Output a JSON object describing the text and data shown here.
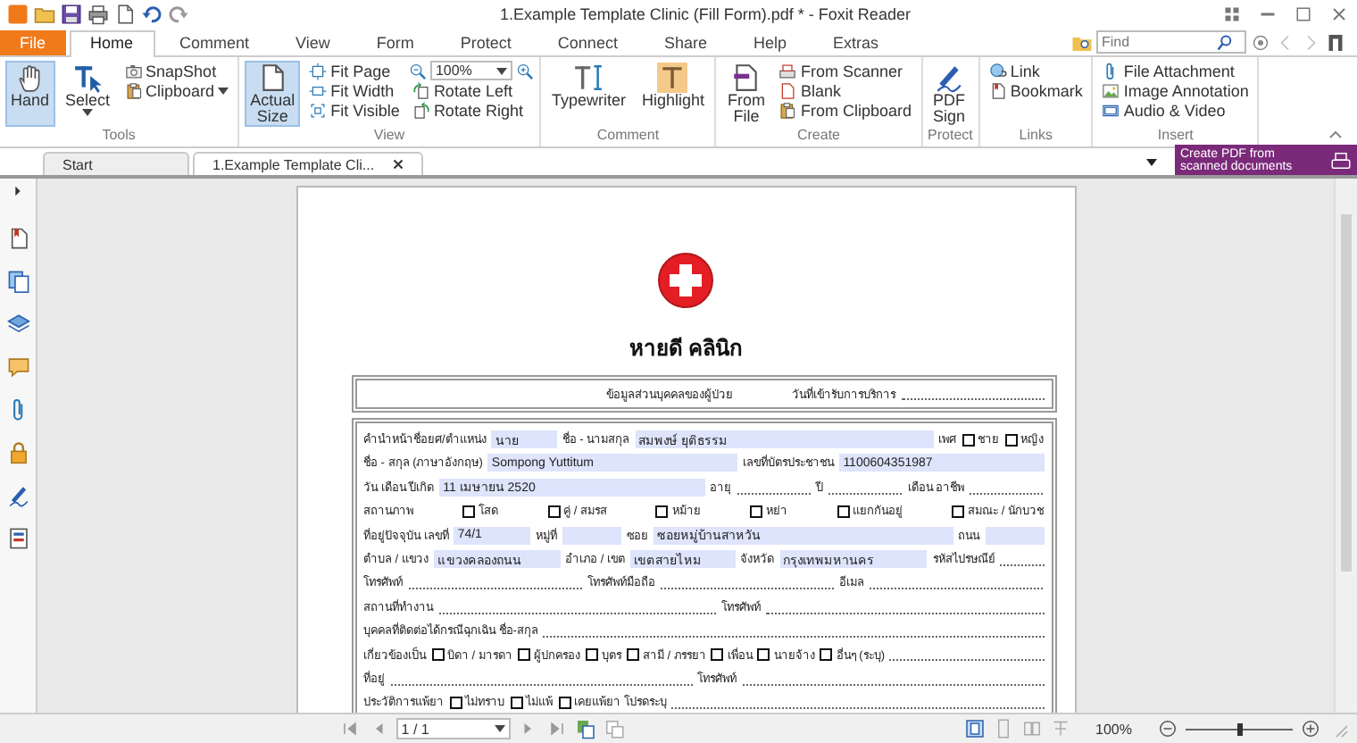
{
  "window": {
    "title": "1.Example Template Clinic (Fill Form).pdf * - Foxit Reader"
  },
  "menu_tabs": [
    {
      "label": "File",
      "kind": "file",
      "selected": false
    },
    {
      "label": "Home",
      "kind": "tab",
      "selected": true
    },
    {
      "label": "Comment",
      "kind": "tab",
      "selected": false
    },
    {
      "label": "View",
      "kind": "tab",
      "selected": false
    },
    {
      "label": "Form",
      "kind": "tab",
      "selected": false
    },
    {
      "label": "Protect",
      "kind": "tab",
      "selected": false
    },
    {
      "label": "Connect",
      "kind": "tab",
      "selected": false
    },
    {
      "label": "Share",
      "kind": "tab",
      "selected": false
    },
    {
      "label": "Help",
      "kind": "tab",
      "selected": false
    },
    {
      "label": "Extras",
      "kind": "tab",
      "selected": false
    }
  ],
  "find": {
    "placeholder": "Find"
  },
  "ribbon": [
    {
      "label": "Tools",
      "items": [
        {
          "label": "Hand",
          "kind": "large",
          "selected": true
        },
        {
          "label": "Select",
          "kind": "large",
          "selected": false,
          "dropdown": true
        },
        {
          "label": "SnapShot",
          "kind": "small",
          "selected": false
        },
        {
          "label": "Clipboard",
          "kind": "small",
          "selected": false,
          "dropdown": true
        }
      ]
    },
    {
      "label": "View",
      "items": [
        {
          "label": "Actual Size",
          "kind": "large",
          "selected": true
        },
        {
          "label": "Fit Page",
          "kind": "small",
          "selected": false
        },
        {
          "label": "Fit Width",
          "kind": "small",
          "selected": false
        },
        {
          "label": "Fit Visible",
          "kind": "small",
          "selected": false
        },
        {
          "kind": "zoom",
          "value": "100%"
        },
        {
          "label": "Rotate Left",
          "kind": "small",
          "selected": false
        },
        {
          "label": "Rotate Right",
          "kind": "small",
          "selected": false
        }
      ]
    },
    {
      "label": "Comment",
      "items": [
        {
          "label": "Typewriter",
          "kind": "large",
          "selected": false
        },
        {
          "label": "Highlight",
          "kind": "large",
          "selected": false
        }
      ]
    },
    {
      "label": "Create",
      "items": [
        {
          "label": "From File",
          "kind": "large",
          "selected": false
        },
        {
          "label": "From Scanner",
          "kind": "small",
          "selected": false
        },
        {
          "label": "Blank",
          "kind": "small",
          "selected": false
        },
        {
          "label": "From Clipboard",
          "kind": "small",
          "selected": false
        }
      ]
    },
    {
      "label": "Protect",
      "items": [
        {
          "label": "PDF Sign",
          "kind": "large",
          "selected": false
        }
      ]
    },
    {
      "label": "Links",
      "items": [
        {
          "label": "Link",
          "kind": "small",
          "selected": false
        },
        {
          "label": "Bookmark",
          "kind": "small",
          "selected": false
        }
      ]
    },
    {
      "label": "Insert",
      "items": [
        {
          "label": "File Attachment",
          "kind": "small",
          "selected": false
        },
        {
          "label": "Image Annotation",
          "kind": "small",
          "selected": false
        },
        {
          "label": "Audio & Video",
          "kind": "small",
          "selected": false
        }
      ]
    }
  ],
  "doc_tabs": [
    {
      "label": "Start",
      "selected": false
    },
    {
      "label": "1.Example Template Cli...",
      "selected": true,
      "closable": true
    }
  ],
  "promo": {
    "text": "Create PDF from scanned documents"
  },
  "document": {
    "title": "หายดี คลินิก",
    "header": [
      {
        "kind": "text",
        "text": "ข้อมูลส่วนบุคคลของผู้ป่วย"
      },
      {
        "kind": "text",
        "text": "วันที่เข้ารับการบริการ",
        "leader": true
      }
    ],
    "rows": [
      {
        "items": [
          {
            "kind": "text",
            "text": "คำนำหน้าชื่อยศ/ตำแหน่ง"
          },
          {
            "kind": "field",
            "value": "นาย"
          },
          {
            "kind": "text",
            "text": "ชื่อ - นามสกุล"
          },
          {
            "kind": "field",
            "value": "สมพงษ์ ยุติธรรม"
          },
          {
            "kind": "text",
            "text": "เพศ"
          },
          {
            "kind": "check",
            "text": "ชาย",
            "checked": false
          },
          {
            "kind": "check",
            "text": "หญิง",
            "checked": false
          }
        ]
      },
      {
        "items": [
          {
            "kind": "text",
            "text": "ชื่อ - สกุล (ภาษาอังกฤษ)"
          },
          {
            "kind": "field",
            "value": "Sompong Yuttitum"
          },
          {
            "kind": "text",
            "text": "เลขที่บัตรประชาชน"
          },
          {
            "kind": "field",
            "value": "1100604351987"
          }
        ]
      },
      {
        "items": [
          {
            "kind": "text",
            "text": "วัน เดือน ปีเกิด"
          },
          {
            "kind": "field",
            "value": "11 เมษายน 2520"
          },
          {
            "kind": "text",
            "text": "อายุ",
            "leader": true
          },
          {
            "kind": "text",
            "text": "ปี",
            "leader": true
          },
          {
            "kind": "text",
            "text": "เดือน อาชีพ",
            "leader": true
          }
        ]
      },
      {
        "items": [
          {
            "kind": "text",
            "text": "สถานภาพ"
          },
          {
            "kind": "check",
            "text": "โสด",
            "checked": false
          },
          {
            "kind": "check",
            "text": "คู่ / สมรส",
            "checked": false
          },
          {
            "kind": "check",
            "text": "หม้าย",
            "checked": false
          },
          {
            "kind": "check",
            "text": "หย่า",
            "checked": false
          },
          {
            "kind": "check",
            "text": "แยกกันอยู่",
            "checked": false
          },
          {
            "kind": "check",
            "text": "สมณะ / นักบวช",
            "checked": false
          }
        ]
      },
      {
        "items": [
          {
            "kind": "text",
            "text": "ที่อยู่ปัจจุบัน เลขที่"
          },
          {
            "kind": "field",
            "value": "74/1"
          },
          {
            "kind": "text",
            "text": "หมู่ที่"
          },
          {
            "kind": "field"
          },
          {
            "kind": "text",
            "text": "ซอย"
          },
          {
            "kind": "field",
            "value": "ซอยหมู่บ้านสาหวัน"
          },
          {
            "kind": "text",
            "text": "ถนน"
          },
          {
            "kind": "field"
          }
        ]
      },
      {
        "items": [
          {
            "kind": "text",
            "text": "ตำบล / แขวง"
          },
          {
            "kind": "field",
            "value": "แขวงคลองถนน"
          },
          {
            "kind": "text",
            "text": "อำเภอ / เขต"
          },
          {
            "kind": "field",
            "value": "เขตสายไหม"
          },
          {
            "kind": "text",
            "text": "จังหวัด"
          },
          {
            "kind": "field",
            "value": "กรุงเทพมหานคร"
          },
          {
            "kind": "text",
            "text": "รหัสไปรษณีย์",
            "leader": true
          }
        ]
      },
      {
        "items": [
          {
            "kind": "text",
            "text": "โทรศัพท์",
            "leader": true
          },
          {
            "kind": "text",
            "text": "โทรศัพท์มือถือ",
            "leader": true
          },
          {
            "kind": "text",
            "text": "อีเมล",
            "leader": true
          }
        ]
      },
      {
        "items": [
          {
            "kind": "text",
            "text": "สถานที่ทำงาน",
            "leader": true
          },
          {
            "kind": "text",
            "text": "โทรศัพท์",
            "leader": true
          }
        ]
      },
      {
        "items": [
          {
            "kind": "text",
            "text": "บุคคลที่ติดต่อได้กรณีฉุกเฉิน ชื่อ-สกุล",
            "leader": true
          }
        ]
      },
      {
        "items": [
          {
            "kind": "text",
            "text": "เกี่ยวข้องเป็น"
          },
          {
            "kind": "check",
            "text": "บิดา / มารดา",
            "checked": false
          },
          {
            "kind": "check",
            "text": "ผู้ปกครอง",
            "checked": false
          },
          {
            "kind": "check",
            "text": "บุตร",
            "checked": false
          },
          {
            "kind": "check",
            "text": "สามี / ภรรยา",
            "checked": false
          },
          {
            "kind": "check",
            "text": "เพื่อน",
            "checked": false
          },
          {
            "kind": "check",
            "text": "นายจ้าง",
            "checked": false
          },
          {
            "kind": "check",
            "text": "อื่นๆ (ระบุ)",
            "checked": false,
            "leader": true
          }
        ]
      },
      {
        "items": [
          {
            "kind": "text",
            "text": "ที่อยู่",
            "leader": true
          },
          {
            "kind": "text",
            "text": "โทรศัพท์",
            "leader": true
          }
        ]
      },
      {
        "items": [
          {
            "kind": "text",
            "text": "ประวัติการแพ้ยา"
          },
          {
            "kind": "check",
            "text": "ไม่ทราบ",
            "checked": false
          },
          {
            "kind": "check",
            "text": "ไม่แพ้",
            "checked": false
          },
          {
            "kind": "check",
            "text": "เคยแพ้ยา โปรดระบุ",
            "checked": false,
            "leader": true
          }
        ]
      }
    ]
  },
  "status_bar": {
    "page": "1 / 1",
    "zoom": "100%",
    "zoom_slider": {
      "level": 0.5
    }
  }
}
